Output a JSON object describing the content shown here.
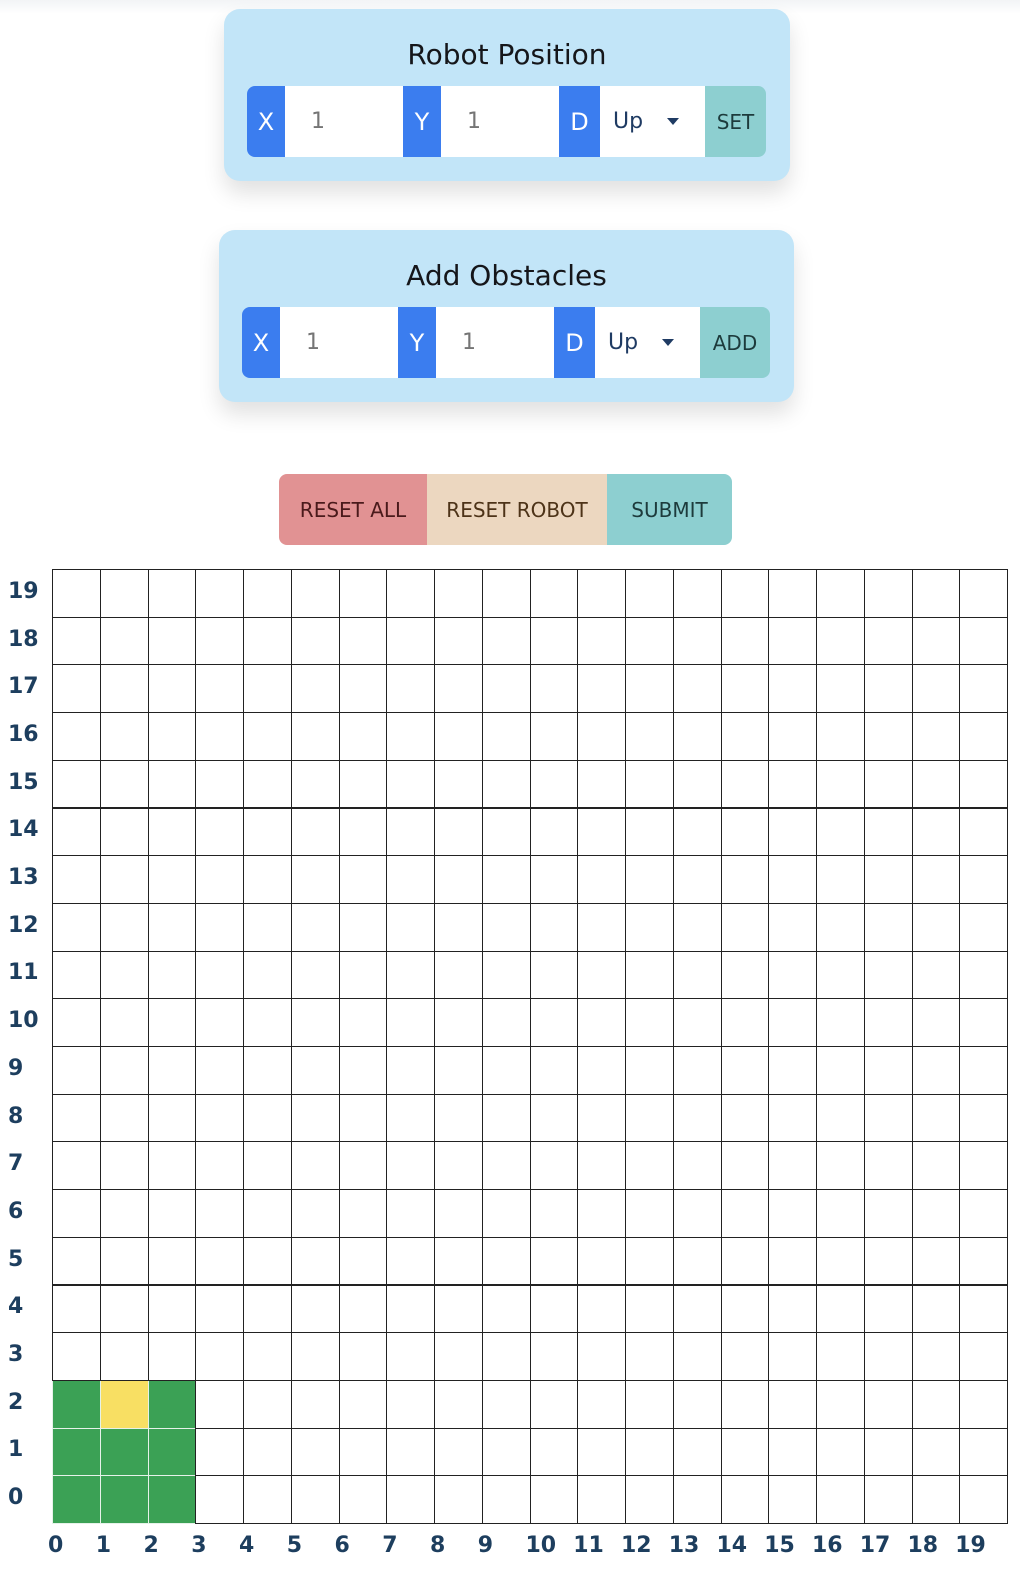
{
  "robot_panel": {
    "title": "Robot Position",
    "x_label": "X",
    "x_placeholder": "1",
    "y_label": "Y",
    "y_placeholder": "1",
    "d_label": "D",
    "direction": "Up",
    "button": "SET"
  },
  "obstacle_panel": {
    "title": "Add Obstacles",
    "x_label": "X",
    "x_placeholder": "1",
    "y_label": "Y",
    "y_placeholder": "1",
    "d_label": "D",
    "direction": "Up",
    "button": "ADD"
  },
  "actions": {
    "reset_all": "RESET ALL",
    "reset_robot": "RESET ROBOT",
    "submit": "SUBMIT"
  },
  "grid": {
    "cols": 20,
    "rows": 20,
    "x_labels": [
      "0",
      "1",
      "2",
      "3",
      "4",
      "5",
      "6",
      "7",
      "8",
      "9",
      "10",
      "11",
      "12",
      "13",
      "14",
      "15",
      "16",
      "17",
      "18",
      "19"
    ],
    "y_labels": [
      "0",
      "1",
      "2",
      "3",
      "4",
      "5",
      "6",
      "7",
      "8",
      "9",
      "10",
      "11",
      "12",
      "13",
      "14",
      "15",
      "16",
      "17",
      "18",
      "19"
    ],
    "robot_cells": [
      [
        0,
        0
      ],
      [
        1,
        0
      ],
      [
        2,
        0
      ],
      [
        0,
        1
      ],
      [
        1,
        1
      ],
      [
        2,
        1
      ],
      [
        0,
        2
      ],
      [
        2,
        2
      ]
    ],
    "robot_heading_cell": [
      1,
      2
    ],
    "colors": {
      "robot": "#3ba155",
      "heading": "#f8df63",
      "empty": "#ffffff",
      "border": "#222222",
      "robot_border": "#e6f2e9"
    }
  },
  "colors": {
    "card_bg": "#c2e5f8",
    "tag_blue": "#3b7def",
    "teal": "#8dcfd0",
    "reset_all": "#e19293",
    "reset_robot": "#ecd7c0"
  }
}
